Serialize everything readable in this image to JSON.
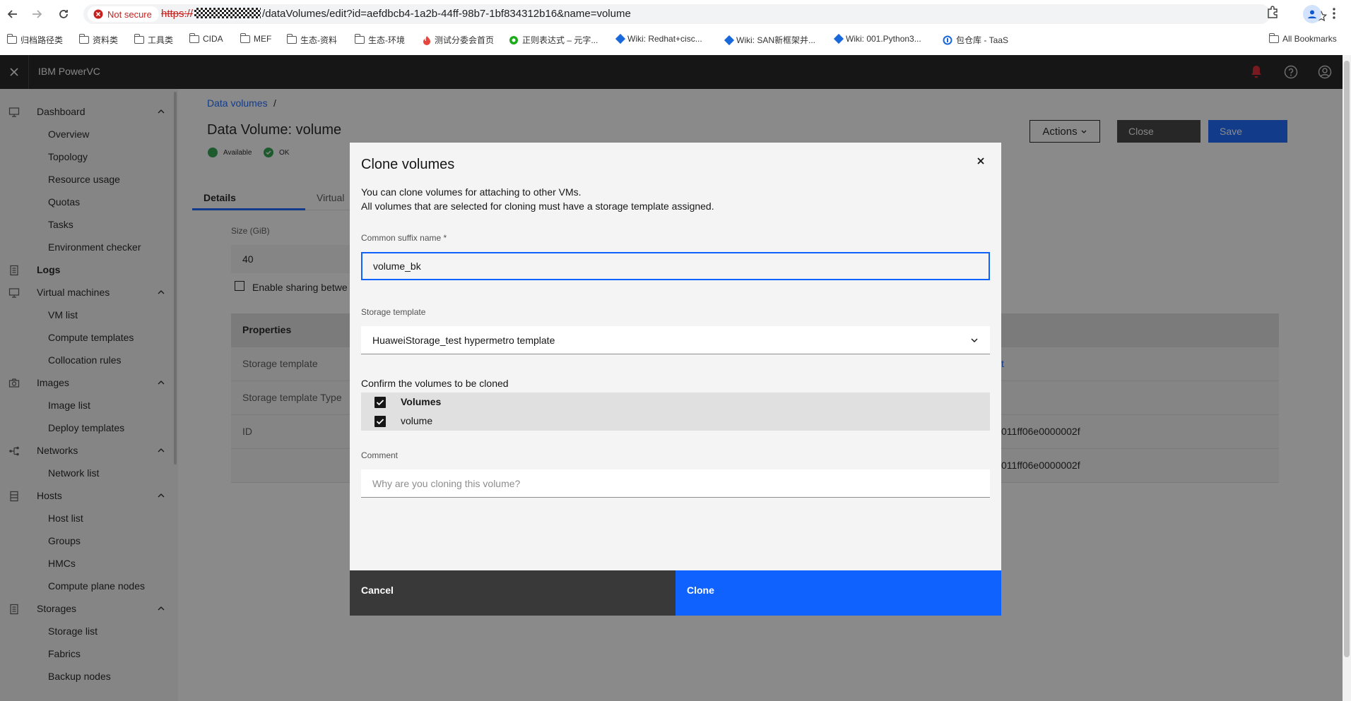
{
  "browser": {
    "security_label": "Not secure",
    "url_scheme": "https://",
    "url_path": "/dataVolumes/edit?id=aefdbcb4-1a2b-44ff-98b7-1bf834312b16&name=volume",
    "bookmarks": [
      "归档路径类",
      "资料类",
      "工具类",
      "CIDA",
      "MEF",
      "生态-资料",
      "生态-环境",
      "测试分委会首页",
      "正则表达式 – 元字...",
      "Wiki: Redhat+cisc...",
      "Wiki: SAN新框架并...",
      "Wiki: 001.Python3...",
      "包仓库 - TaaS"
    ],
    "all_bookmarks": "All Bookmarks"
  },
  "app": {
    "name": "IBM PowerVC"
  },
  "sidebar": {
    "sections": [
      {
        "label": "Dashboard",
        "items": [
          "Overview",
          "Topology",
          "Resource usage",
          "Quotas",
          "Tasks",
          "Environment checker"
        ]
      },
      {
        "label": "Logs",
        "items": []
      },
      {
        "label": "Virtual machines",
        "items": [
          "VM list",
          "Compute templates",
          "Collocation rules"
        ]
      },
      {
        "label": "Images",
        "items": [
          "Image list",
          "Deploy templates"
        ]
      },
      {
        "label": "Networks",
        "items": [
          "Network list"
        ]
      },
      {
        "label": "Hosts",
        "items": [
          "Host list",
          "Groups",
          "HMCs",
          "Compute plane nodes"
        ]
      },
      {
        "label": "Storages",
        "items": [
          "Storage list",
          "Fabrics",
          "Backup nodes"
        ]
      }
    ]
  },
  "page": {
    "breadcrumb": "Data volumes",
    "breadcrumb_sep": "/",
    "title": "Data Volume: volume",
    "status1": "Available",
    "status2": "OK",
    "actions_label": "Actions",
    "close_label": "Close",
    "save_label": "Save",
    "tabs": [
      "Details",
      "Virtual"
    ],
    "size_label": "Size (GiB)",
    "size_value": "40",
    "sharing_label": "Enable sharing betwe",
    "properties_header": "Properties",
    "properties": [
      {
        "key": "Storage template",
        "value": "t"
      },
      {
        "key": "Storage template Type",
        "value": ""
      },
      {
        "key": "ID",
        "value": "011ff06e0000002f"
      },
      {
        "key": "",
        "value": "011ff06e0000002f"
      }
    ]
  },
  "modal": {
    "title": "Clone volumes",
    "desc1": "You can clone volumes for attaching to other VMs.",
    "desc2": "All volumes that are selected for cloning must have a storage template assigned.",
    "suffix_label": "Common suffix name *",
    "suffix_value": "volume_bk",
    "template_label": "Storage template",
    "template_value": "HuaweiStorage_test hypermetro template",
    "confirm_label": "Confirm the volumes to be cloned",
    "volumes_header": "Volumes",
    "volumes": [
      "volume"
    ],
    "comment_label": "Comment",
    "comment_placeholder": "Why are you cloning this volume?",
    "cancel_label": "Cancel",
    "clone_label": "Clone"
  },
  "colors": {
    "primary": "#0f62fe",
    "header_bg": "#161616",
    "status_green": "#24a148",
    "notification_red": "#da1e28"
  }
}
